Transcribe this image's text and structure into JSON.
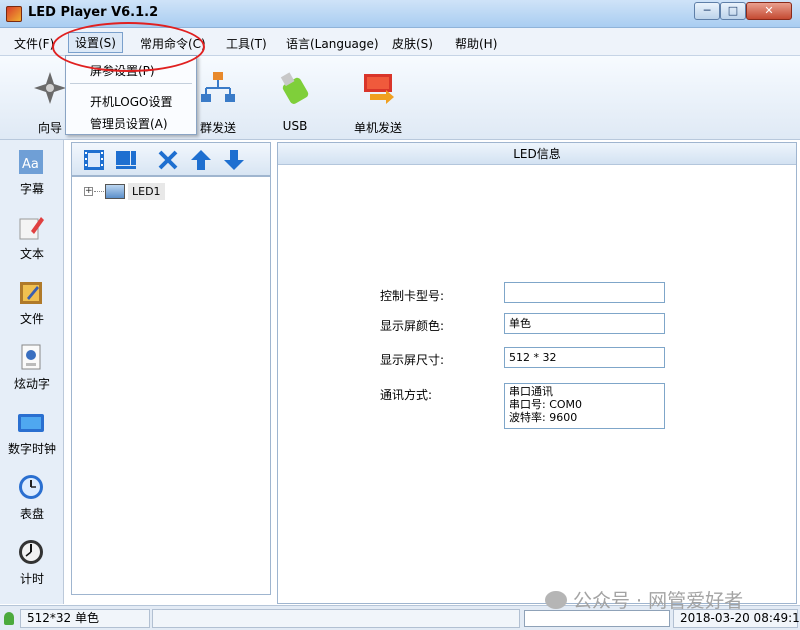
{
  "window": {
    "title": "LED Player V6.1.2",
    "min_glyph": "─",
    "max_glyph": "□",
    "close_glyph": "✕"
  },
  "menubar": [
    {
      "label": "文件(F)"
    },
    {
      "label": "设置(S)"
    },
    {
      "label": "常用命令(C)"
    },
    {
      "label": "工具(T)"
    },
    {
      "label": "语言(Language)"
    },
    {
      "label": "皮肤(S)"
    },
    {
      "label": "帮助(H)"
    }
  ],
  "settings_menu": {
    "items": [
      {
        "label": "屏参设置(P)"
      },
      {
        "label": "开机LOGO设置"
      },
      {
        "label": "管理员设置(A)"
      }
    ]
  },
  "toolbar": [
    {
      "label": "向导",
      "icon": "wizard-icon"
    },
    {
      "label": "群发送",
      "icon": "network-icon"
    },
    {
      "label": "USB",
      "icon": "usb-icon"
    },
    {
      "label": "单机发送",
      "icon": "send-icon"
    }
  ],
  "sidebar": [
    {
      "label": "字幕",
      "icon": "subtitle-icon"
    },
    {
      "label": "文本",
      "icon": "text-icon"
    },
    {
      "label": "文件",
      "icon": "file-icon"
    },
    {
      "label": "炫动字",
      "icon": "animated-text-icon"
    },
    {
      "label": "数字时钟",
      "icon": "digital-clock-icon"
    },
    {
      "label": "表盘",
      "icon": "dial-clock-icon"
    },
    {
      "label": "计时",
      "icon": "timer-icon"
    }
  ],
  "tree": {
    "expander": "+",
    "nodes": [
      {
        "label": "LED1"
      }
    ]
  },
  "info": {
    "header": "LED信息",
    "fields": [
      {
        "label": "控制卡型号:",
        "value": ""
      },
      {
        "label": "显示屏颜色:",
        "value": "单色"
      },
      {
        "label": "显示屏尺寸:",
        "value": "512 * 32"
      }
    ],
    "comm": {
      "label": "通讯方式:",
      "lines": [
        "串口通讯",
        "串口号: COM0",
        "波特率: 9600"
      ]
    }
  },
  "status": {
    "screen_info": "512*32 单色",
    "datetime": "2018-03-20 08:49:19",
    "progress_fraction": 0.0
  },
  "watermark": "公众号 · 网管爱好者"
}
